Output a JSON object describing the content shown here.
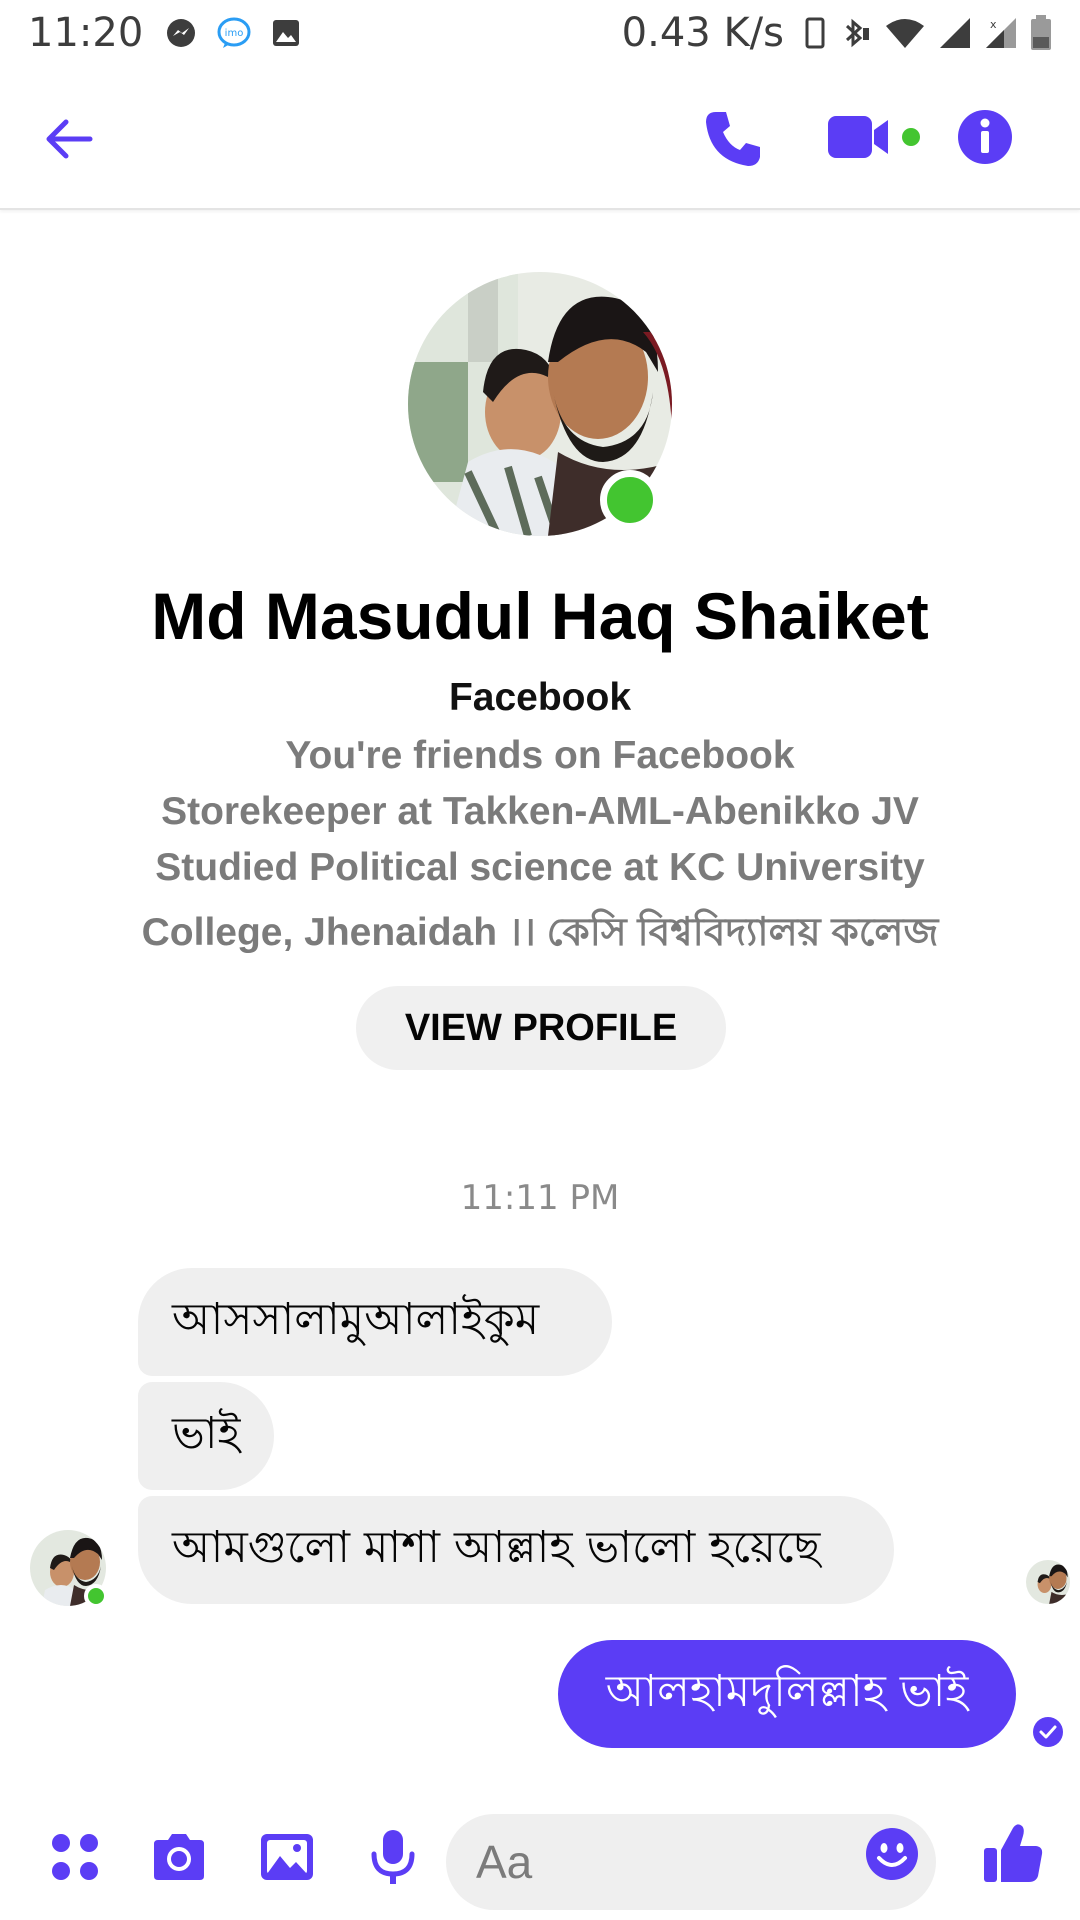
{
  "status_bar": {
    "time": "11:20",
    "net_speed": "0.43 K/s",
    "left_icons": [
      "messenger-icon",
      "imo-icon",
      "gallery-icon"
    ],
    "right_icons": [
      "vibrate-icon",
      "bluetooth-icon",
      "wifi-icon",
      "signal-icon",
      "signal-icon",
      "battery-icon"
    ]
  },
  "header": {
    "back_icon": "back-arrow-icon",
    "call_icon": "phone-icon",
    "video_icon": "video-camera-icon",
    "info_icon": "info-icon"
  },
  "profile": {
    "name": "Md Masudul Haq Shaiket",
    "source": "Facebook",
    "lines": [
      "You're friends on Facebook",
      "Storekeeper at Takken-AML-Abenikko JV",
      "Studied Political science at KC University",
      "College, Jhenaidah ।। কেসি বিশ্ববিদ্যালয় কলেজ"
    ],
    "view_profile_label": "VIEW PROFILE",
    "online": true
  },
  "conversation": {
    "timestamp": "11:11 PM",
    "incoming": [
      "আসসালামুআলাইকুম",
      "ভাই",
      "আমগুলো মাশা আল্লাহ ভালো হয়েছে"
    ],
    "outgoing": [
      "আলহামদুলিল্লাহ ভাই"
    ]
  },
  "composer": {
    "placeholder": "Aa",
    "icons": [
      "apps-icon",
      "camera-icon",
      "image-icon",
      "microphone-icon",
      "emoji-icon",
      "thumbs-up-icon"
    ]
  },
  "colors": {
    "accent": "#5b3df5",
    "online": "#43c530",
    "incoming_bubble": "#efefef"
  }
}
